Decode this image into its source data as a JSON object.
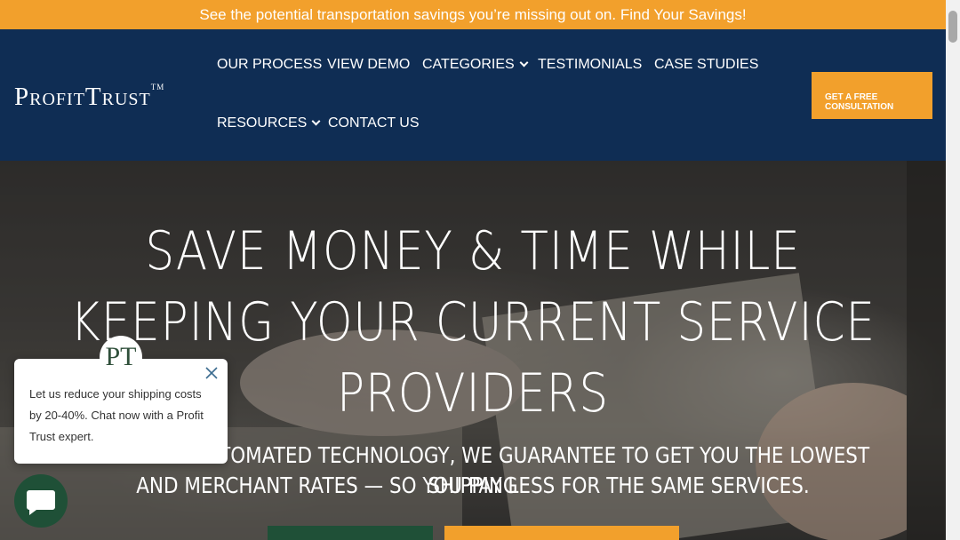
{
  "promo": {
    "text": "See the potential transportation savings you’re missing out on. Find Your Savings!"
  },
  "header": {
    "logo_text": "ProfitTrust",
    "logo_tm": "TM",
    "nav": [
      {
        "label": "OUR PROCESS"
      },
      {
        "label": "VIEW DEMO"
      },
      {
        "label": "CATEGORIES",
        "has_dropdown": true
      },
      {
        "label": "TESTIMONIALS"
      },
      {
        "label": "CASE STUDIES"
      },
      {
        "label": "RESOURCES",
        "has_dropdown": true
      },
      {
        "label": "CONTACT US"
      }
    ],
    "cta_line1": "GET A FREE",
    "cta_line2": "CONSULTATION"
  },
  "hero": {
    "title_line1": "SAVE MONEY & TIME WHILE",
    "title_line2": "KEEPING YOUR CURRENT SERVICE",
    "title_line3": "PROVIDERS",
    "subtitle_line1": "USING OUR AUTOMATED TECHNOLOGY, WE GUARANTEE TO GET YOU THE LOWEST SHIPPING",
    "subtitle_line2": "AND MERCHANT RATES — SO YOU PAY LESS FOR THE SAME SERVICES."
  },
  "chat": {
    "avatar_initials": "PT",
    "message": "Let us reduce your shipping costs by 20-40%. Chat now with a Profit Trust expert.",
    "close_icon": "close-icon",
    "launcher_icon": "chat-bubble-icon"
  },
  "colors": {
    "orange": "#f2a02c",
    "navy": "#0f2d54",
    "green": "#1f5037"
  }
}
